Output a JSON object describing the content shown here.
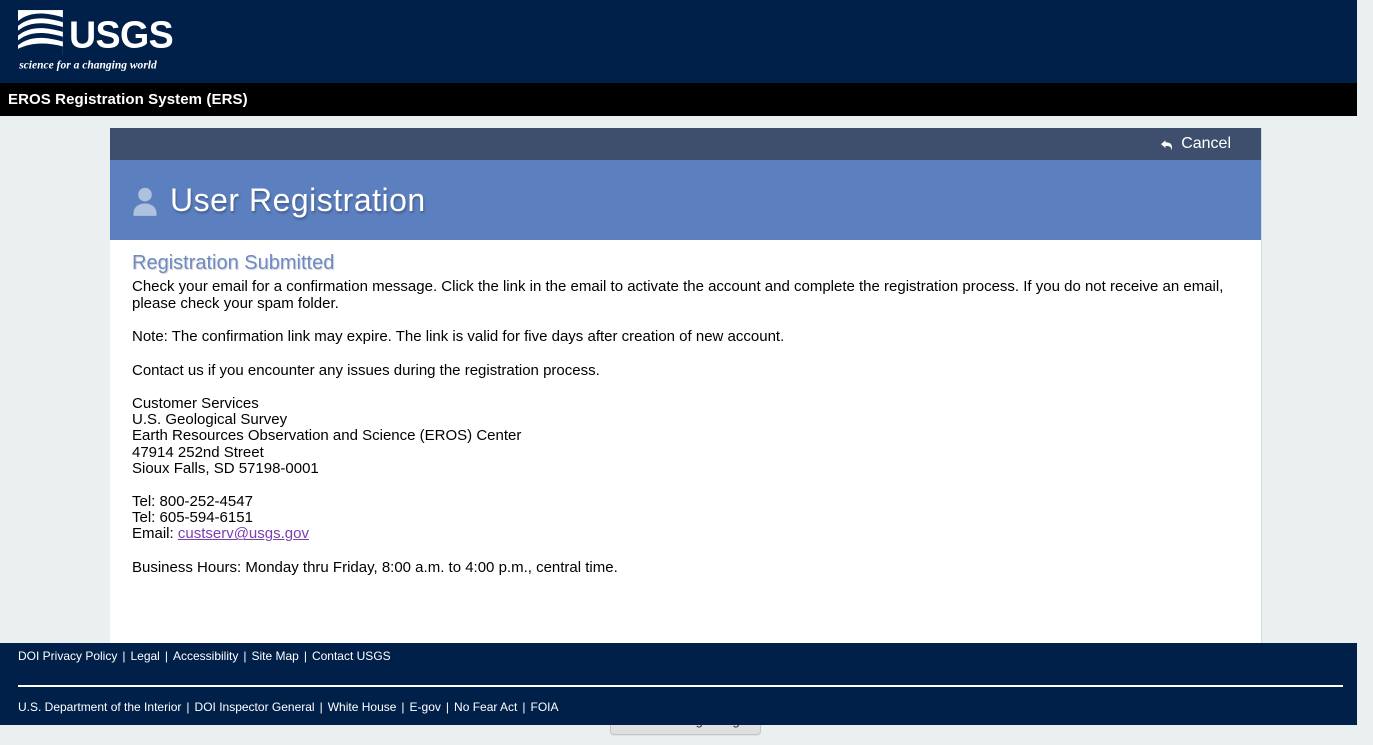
{
  "header": {
    "logo_wordmark": "USGS",
    "logo_tagline": "science for a changing world",
    "logo_icon": "usgs-wave-logo",
    "app_title": "EROS Registration System (ERS)"
  },
  "toolbar": {
    "cancel_label": "Cancel",
    "cancel_icon": "undo-arrow-icon"
  },
  "panel": {
    "title": "User Registration",
    "title_icon": "user-person-icon"
  },
  "content": {
    "section_heading": "Registration Submitted",
    "paragraph_1": "Check your email for a confirmation message. Click the link in the email to activate the account and complete the registration process. If you do not receive an email, please check your spam folder.",
    "paragraph_2": "Note: The confirmation link may expire. The link is valid for five days after creation of new account.",
    "paragraph_3": "Contact us if you encounter any issues during the registration process.",
    "address": [
      "Customer Services",
      "U.S. Geological Survey",
      "Earth Resources Observation and Science (EROS) Center",
      "47914 252nd Street",
      "Sioux Falls, SD 57198-0001"
    ],
    "tel_1": "Tel: 800-252-4547",
    "tel_2": "Tel: 605-594-6151",
    "email_label": "Email:",
    "email_value": "custserv@usgs.gov",
    "business_hours": "Business Hours: Monday thru Friday, 8:00 a.m. to 4:00 p.m., central time.",
    "return_button_label": "Return to Login Page"
  },
  "footer": {
    "row1": [
      "DOI Privacy Policy",
      "Legal",
      "Accessibility",
      "Site Map",
      "Contact USGS"
    ],
    "row2": [
      "U.S. Department of the Interior",
      "DOI Inspector General",
      "White House",
      "E-gov",
      "No Fear Act",
      "FOIA"
    ],
    "separator": "|"
  },
  "colors": {
    "header_navy": "#002049",
    "black_bar": "#000000",
    "toolbar_slate": "#3e4f6e",
    "title_band_blue": "#5b7fbf",
    "heading_blue": "#6d8ac4",
    "page_background": "#eaeff0",
    "email_link": "#7a3fb0"
  }
}
